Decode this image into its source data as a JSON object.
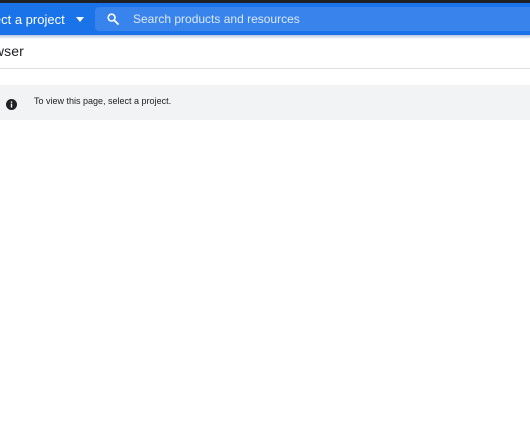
{
  "header": {
    "project_selector_label": "lect a project",
    "search_placeholder": "Search products and resources"
  },
  "page": {
    "title": "owser"
  },
  "notice": {
    "text": "To view this page, select a project."
  },
  "icons": {
    "dropdown": "caret-down-icon",
    "search": "search-icon",
    "info": "info-icon"
  },
  "colors": {
    "header_background": "#1a73e8",
    "search_background": "#3984ec",
    "notice_background": "#f1f3f4",
    "text": "#202124"
  }
}
